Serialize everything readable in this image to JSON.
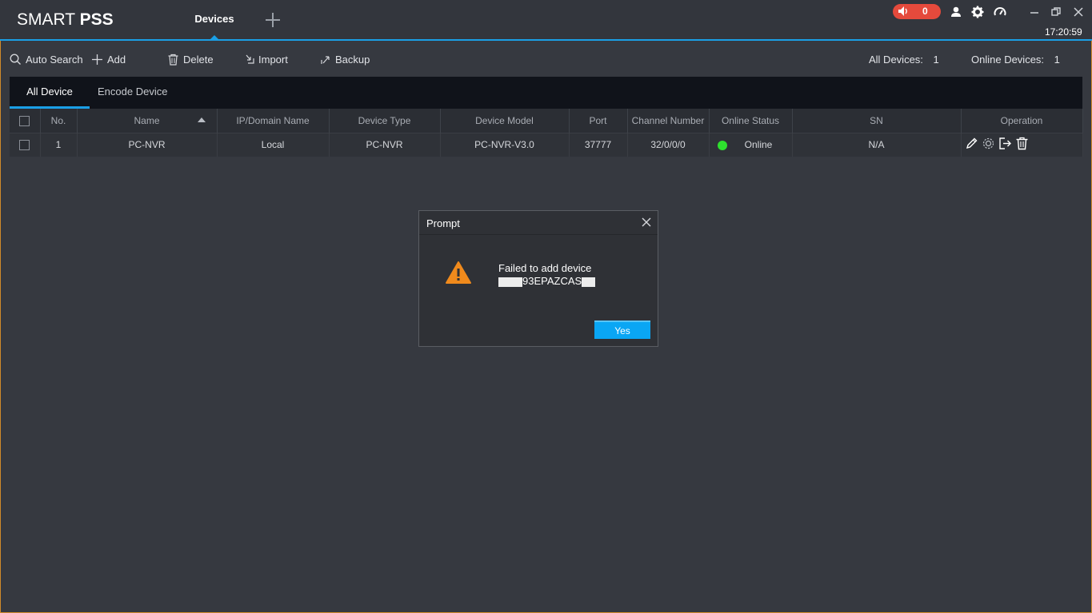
{
  "app": {
    "logo_light": "SMART",
    "logo_bold": "PSS",
    "active_tab": "Devices",
    "alarm_count": "0",
    "clock": "17:20:59"
  },
  "toolbar": {
    "auto_search": "Auto Search",
    "add": "Add",
    "delete": "Delete",
    "import": "Import",
    "backup": "Backup",
    "all_devices_label": "All Devices:",
    "all_devices_count": "1",
    "online_devices_label": "Online Devices:",
    "online_devices_count": "1"
  },
  "subtabs": {
    "all_device": "All Device",
    "encode_device": "Encode Device"
  },
  "table": {
    "headers": [
      "No.",
      "Name",
      "IP/Domain Name",
      "Device Type",
      "Device Model",
      "Port",
      "Channel Number",
      "Online Status",
      "SN",
      "Operation"
    ],
    "rows": [
      {
        "no": "1",
        "name": "PC-NVR",
        "ip": "Local",
        "type": "PC-NVR",
        "model": "PC-NVR-V3.0",
        "port": "37777",
        "channel": "32/0/0/0",
        "status": "Online",
        "sn": "N/A"
      }
    ]
  },
  "dialog": {
    "title": "Prompt",
    "message": "Failed to add device",
    "device_id_visible": "93EPAZCAS",
    "yes": "Yes"
  },
  "colors": {
    "accent": "#1a9fe6",
    "alarm": "#e54a3c",
    "online": "#2ee02e",
    "warning": "#f08a1c",
    "button": "#0aa6f4"
  }
}
